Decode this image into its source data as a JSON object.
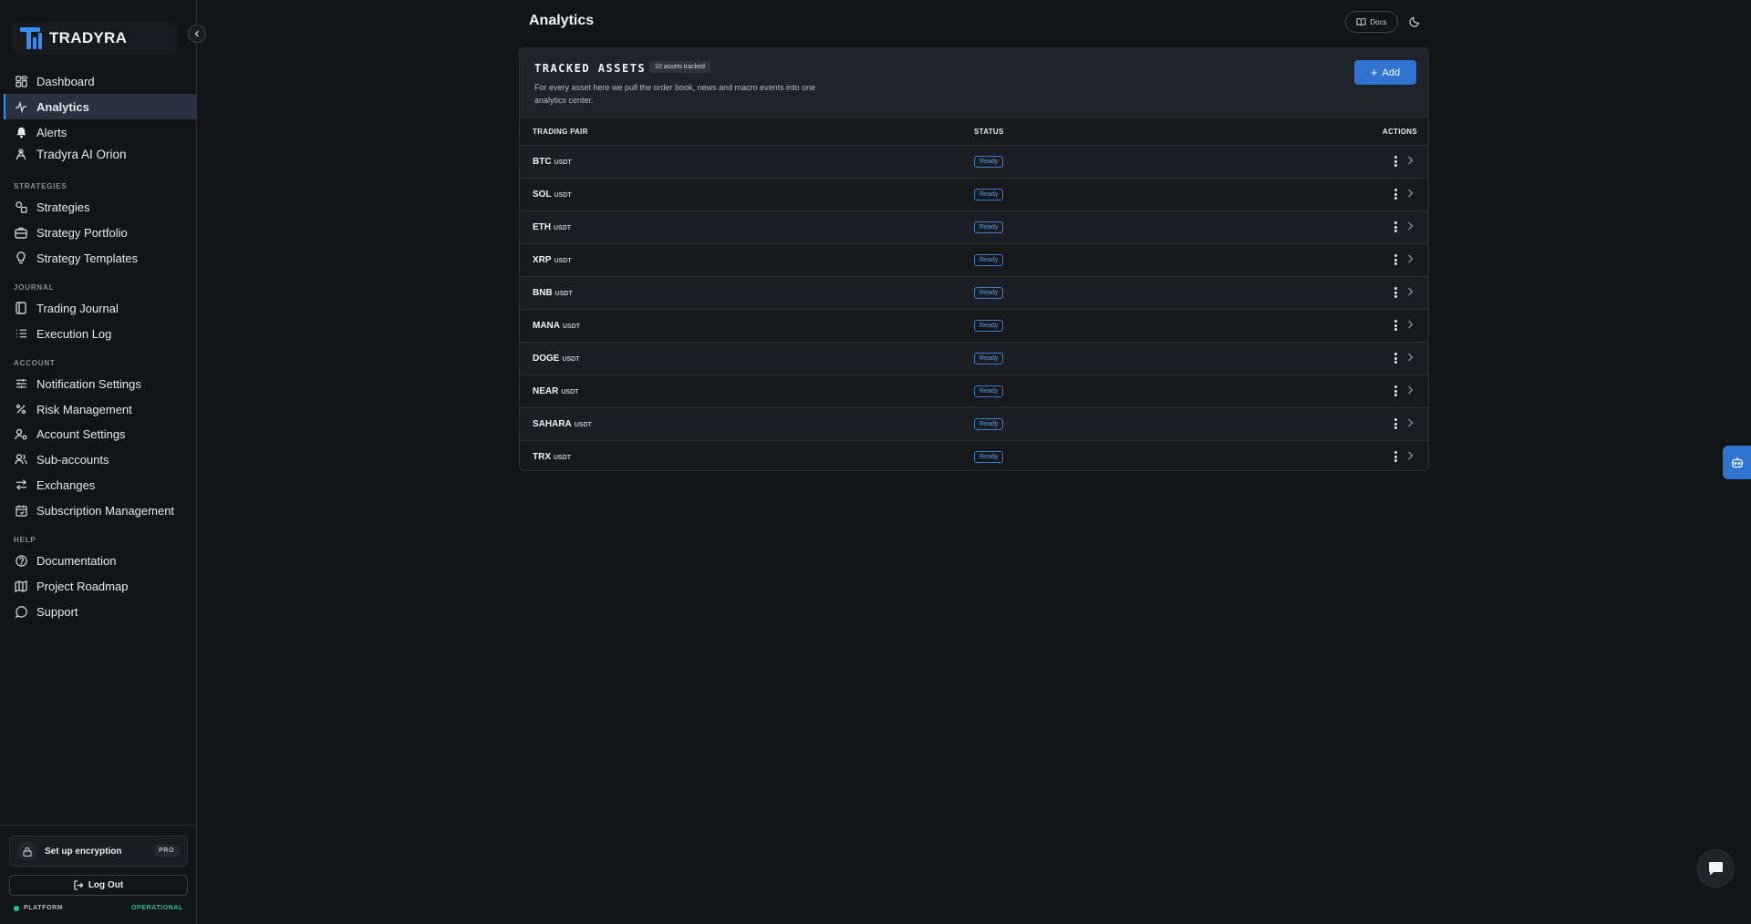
{
  "brand": {
    "name": "TRADYRA"
  },
  "header": {
    "title": "Analytics",
    "docs_label": "Docs"
  },
  "sidebar": {
    "items": [
      {
        "label": "Dashboard",
        "icon": "dashboard-icon"
      },
      {
        "label": "Analytics",
        "icon": "activity-icon",
        "active": true
      },
      {
        "label": "Alerts",
        "icon": "bell-icon"
      },
      {
        "label": "Tradyra AI Orion",
        "icon": "orion-icon"
      }
    ],
    "sections": [
      {
        "label": "STRATEGIES",
        "items": [
          {
            "label": "Strategies",
            "icon": "shapes-icon"
          },
          {
            "label": "Strategy Portfolio",
            "icon": "briefcase-icon"
          },
          {
            "label": "Strategy Templates",
            "icon": "lightbulb-icon"
          }
        ]
      },
      {
        "label": "JOURNAL",
        "items": [
          {
            "label": "Trading Journal",
            "icon": "book-icon"
          },
          {
            "label": "Execution Log",
            "icon": "list-icon"
          }
        ]
      },
      {
        "label": "ACCOUNT",
        "items": [
          {
            "label": "Notification Settings",
            "icon": "sliders-icon"
          },
          {
            "label": "Risk Management",
            "icon": "percent-icon"
          },
          {
            "label": "Account Settings",
            "icon": "user-cog-icon"
          },
          {
            "label": "Sub-accounts",
            "icon": "users-icon"
          },
          {
            "label": "Exchanges",
            "icon": "arrows-icon"
          },
          {
            "label": "Subscription Management",
            "icon": "calendar-icon"
          }
        ]
      },
      {
        "label": "HELP",
        "items": [
          {
            "label": "Documentation",
            "icon": "help-circle-icon"
          },
          {
            "label": "Project Roadmap",
            "icon": "map-icon"
          },
          {
            "label": "Support",
            "icon": "message-icon"
          }
        ]
      }
    ],
    "encryption": {
      "label": "Set up encryption",
      "badge": "PRO"
    },
    "logout_label": "Log Out",
    "platform": {
      "label": "PLATFORM",
      "status": "OPERATIONAL",
      "status_color": "#22c58b"
    }
  },
  "tracked_assets": {
    "title": "TRACKED ASSETS",
    "count_label": "10 assets tracked",
    "description": "For every asset here we pull the order book, news and macro events into one analytics center.",
    "add_label": "Add",
    "columns": [
      "TRADING PAIR",
      "STATUS",
      "ACTIONS"
    ],
    "rows": [
      {
        "base": "BTC",
        "quote": "USDT",
        "status": "Ready"
      },
      {
        "base": "SOL",
        "quote": "USDT",
        "status": "Ready"
      },
      {
        "base": "ETH",
        "quote": "USDT",
        "status": "Ready"
      },
      {
        "base": "XRP",
        "quote": "USDT",
        "status": "Ready"
      },
      {
        "base": "BNB",
        "quote": "USDT",
        "status": "Ready"
      },
      {
        "base": "MANA",
        "quote": "USDT",
        "status": "Ready"
      },
      {
        "base": "DOGE",
        "quote": "USDT",
        "status": "Ready"
      },
      {
        "base": "NEAR",
        "quote": "USDT",
        "status": "Ready"
      },
      {
        "base": "SAHARA",
        "quote": "USDT",
        "status": "Ready"
      },
      {
        "base": "TRX",
        "quote": "USDT",
        "status": "Ready"
      }
    ]
  },
  "colors": {
    "accent": "#3b8bf0",
    "primary_button": "#2f74d0",
    "status_ready": "#4aa3ff"
  }
}
